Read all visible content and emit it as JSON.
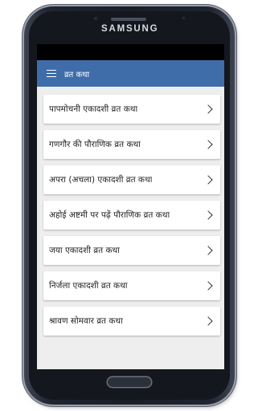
{
  "device": {
    "brand": "SAMSUNG"
  },
  "app_bar": {
    "menu_icon": "hamburger-menu-icon",
    "title": "व्रत कथा",
    "color": "#3f6daa"
  },
  "list": {
    "items": [
      {
        "label": "पापमोचनी एकादशी व्रत कथा"
      },
      {
        "label": "गणगौर की पौराणिक व्रत कथा"
      },
      {
        "label": "अपरा (अचला) एकादशी व्रत कथा"
      },
      {
        "label": "अहोई अष्टमी पर पढ़ें पौराणिक व्रत कथा"
      },
      {
        "label": "जया एकादशी व्रत कथा"
      },
      {
        "label": "निर्जला एकादशी व्रत कथा"
      },
      {
        "label": "श्रावण सोमवार व्रत कथा"
      }
    ],
    "item_icon": "chevron-right-icon"
  }
}
